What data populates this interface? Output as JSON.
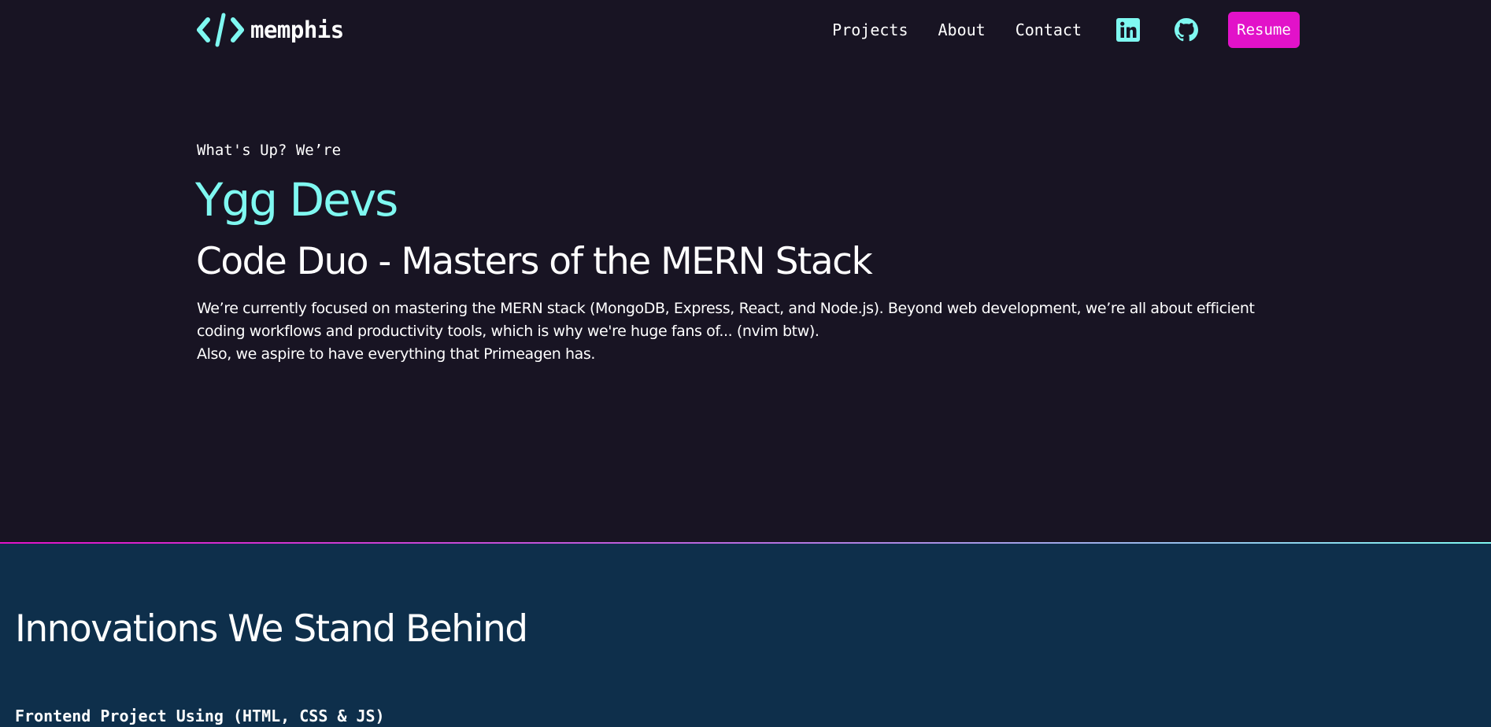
{
  "brand": {
    "name": "memphis",
    "accent_color": "#7ff8f1",
    "logo_icon": "code-brackets-icon"
  },
  "nav": {
    "links": [
      {
        "label": "Projects"
      },
      {
        "label": "About"
      },
      {
        "label": "Contact"
      }
    ],
    "social_icons": [
      "linkedin-icon",
      "github-icon"
    ],
    "resume_label": "Resume",
    "resume_color": "#e212c9"
  },
  "hero": {
    "kicker": "What's Up? We’re",
    "name": "Ygg Devs",
    "tagline": "Code Duo - Masters of the MERN Stack",
    "description": [
      "We’re currently focused on mastering the MERN stack (MongoDB, Express, React, and Node.js). Beyond web development, we’re all about efficient coding workflows and productivity tools, which is why we're huge fans of... (nvim btw).",
      "Also, we aspire to have everything that Primeagen has."
    ]
  },
  "projects": {
    "title": "Innovations We Stand Behind",
    "first_project_title": "Frontend Project Using (HTML, CSS & JS)",
    "background_color": "#0e2f4b"
  },
  "colors": {
    "page_background": "#181423",
    "text": "#ffffff"
  }
}
